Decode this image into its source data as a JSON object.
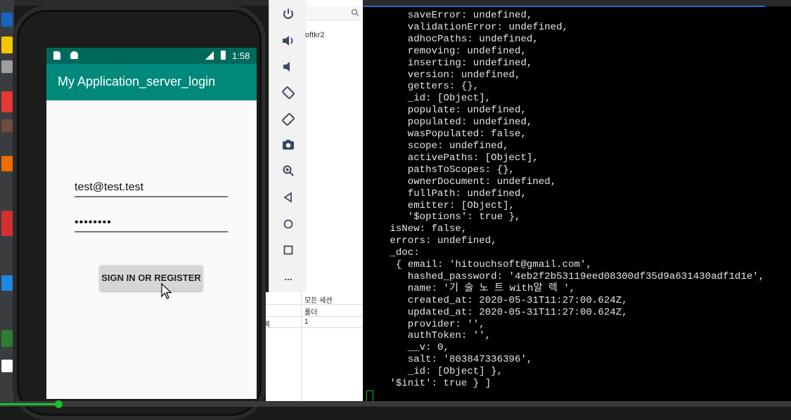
{
  "phone": {
    "status_time": "1:58",
    "app_title": "My Application_server_login",
    "email_value": "test@test.test",
    "password_value": "••••••••",
    "signin_label": "SIGN IN OR REGISTER"
  },
  "toolbar": {
    "icons": [
      "power-icon",
      "volume-up-icon",
      "volume-down-icon",
      "rotate-left-icon",
      "rotate-right-icon",
      "camera-icon",
      "zoom-icon",
      "back-icon",
      "home-icon",
      "overview-icon",
      "more-icon"
    ],
    "more_label": "..."
  },
  "explorer": {
    "partial_text": "oftkr2",
    "props": {
      "header": "모든 세션",
      "row1": "폴더",
      "row2_left": "목",
      "row2_value": "1"
    }
  },
  "terminal": {
    "lines": [
      "      saveError: undefined,",
      "      validationError: undefined,",
      "      adhocPaths: undefined,",
      "      removing: undefined,",
      "      inserting: undefined,",
      "      version: undefined,",
      "      getters: {},",
      "      _id: [Object],",
      "      populate: undefined,",
      "      populated: undefined,",
      "      wasPopulated: false,",
      "      scope: undefined,",
      "      activePaths: [Object],",
      "      pathsToScopes: {},",
      "      ownerDocument: undefined,",
      "      fullPath: undefined,",
      "      emitter: [Object],",
      "      '$options': true },",
      "   isNew: false,",
      "   errors: undefined,",
      "   _doc:",
      "    { email: 'hitouchsoft@gmail.com',",
      "      hashed_password: '4eb2f2b53119eed08300df35d9a631430adf1d1e',",
      "      name: '기 술 노 트 with알 렉 ',",
      "      created_at: 2020-05-31T11:27:00.624Z,",
      "      updated_at: 2020-05-31T11:27:00.624Z,",
      "      provider: '',",
      "      authToken: '',",
      "      __v: 0,",
      "      salt: '803847336396',",
      "      _id: [Object] },",
      "   '$init': true } ]"
    ]
  },
  "video": {
    "progress": 0.074
  },
  "colors": {
    "status_bar": "#00695c",
    "app_bar": "#00897b",
    "terminal_bg": "#000000",
    "progress": "#18c12b"
  }
}
